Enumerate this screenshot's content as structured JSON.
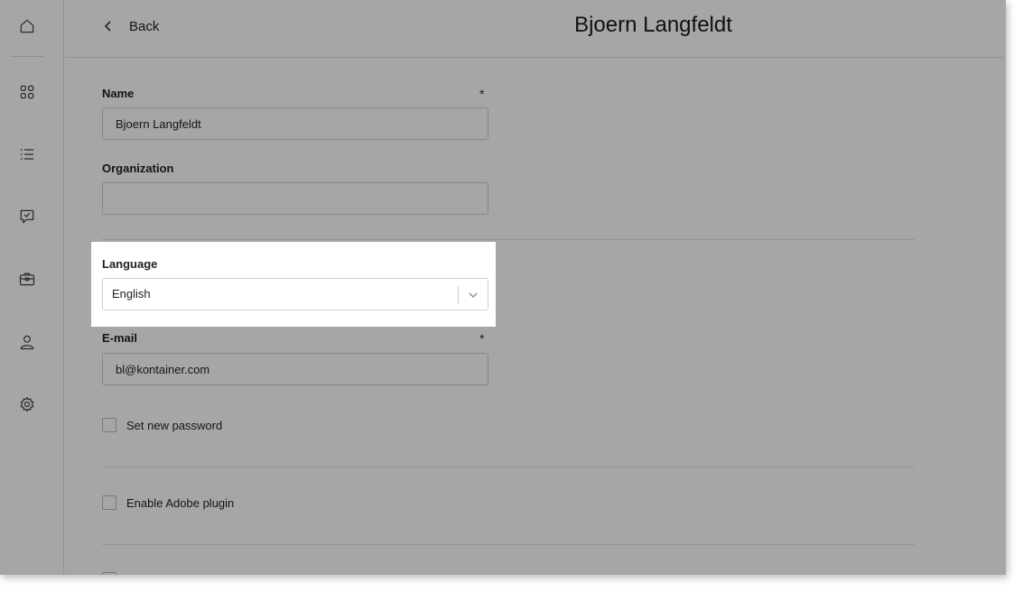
{
  "sidebar": {
    "items": [
      {
        "icon": "home-icon"
      },
      {
        "icon": "grid-icon"
      },
      {
        "icon": "list-icon"
      },
      {
        "icon": "approval-chat-icon"
      },
      {
        "icon": "briefcase-icon"
      },
      {
        "icon": "user-icon"
      },
      {
        "icon": "gear-icon"
      }
    ]
  },
  "header": {
    "back_label": "Back",
    "title": "Bjoern Langfeldt"
  },
  "form": {
    "name": {
      "label": "Name",
      "required_mark": "*",
      "value": "Bjoern Langfeldt"
    },
    "organization": {
      "label": "Organization",
      "value": ""
    },
    "language": {
      "label": "Language",
      "selected": "English"
    },
    "email": {
      "label": "E-mail",
      "required_mark": "*",
      "value": "bl@kontainer.com"
    },
    "set_password": {
      "label": "Set new password",
      "checked": false
    },
    "adobe_plugin": {
      "label": "Enable Adobe plugin",
      "checked": false
    }
  },
  "colors": {
    "overlay": "#000000",
    "border": "#cfcfcf",
    "text": "#222222"
  }
}
